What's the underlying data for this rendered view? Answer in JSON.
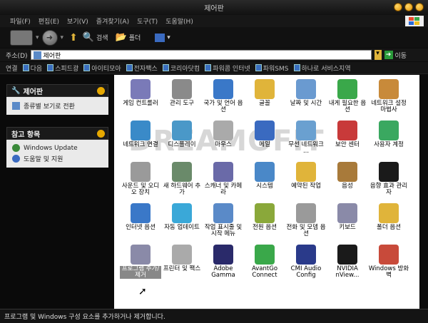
{
  "window": {
    "title": "제어판"
  },
  "menu": [
    "파일(F)",
    "편집(E)",
    "보기(V)",
    "즐겨찾기(A)",
    "도구(T)",
    "도움말(H)"
  ],
  "toolbar": {
    "search": "검색",
    "folders": "폴더"
  },
  "address": {
    "label": "주소(D)",
    "value": "제어판",
    "go": "이동"
  },
  "links": {
    "label": "연결",
    "items": [
      "다음",
      "스피드광",
      "아이티모아",
      "전자팩스",
      "코리아닷컴",
      "파워콤 인터넷",
      "파워SMS",
      "하나로 서비스지역"
    ]
  },
  "sidebar": {
    "control_panel": {
      "title": "제어판",
      "item": "종류별 보기로 전환"
    },
    "see_also": {
      "title": "참고 항목",
      "items": [
        "Windows Update",
        "도움말 및 지원"
      ]
    }
  },
  "watermark": "DREAMOFIT",
  "icons": [
    {
      "label": "게임 컨트롤러",
      "color": "#7a7ab8"
    },
    {
      "label": "관리 도구",
      "color": "#8a8a8a"
    },
    {
      "label": "국가 및 언어 옵션",
      "color": "#3a78c8"
    },
    {
      "label": "글꼴",
      "color": "#e0b43a"
    },
    {
      "label": "날짜 및 시간",
      "color": "#6a9ad0"
    },
    {
      "label": "내게 필요한 옵션",
      "color": "#3aa84a"
    },
    {
      "label": "네트워크 설정 마법사",
      "color": "#c88a3a"
    },
    {
      "label": "네트워크 연결",
      "color": "#3a8ac8"
    },
    {
      "label": "디스플레이",
      "color": "#4a98c8"
    },
    {
      "label": "마우스",
      "color": "#aaaaaa"
    },
    {
      "label": "메일",
      "color": "#3a6ac0"
    },
    {
      "label": "무선 네트워크 ...",
      "color": "#6aa0d0"
    },
    {
      "label": "보안 센터",
      "color": "#c83a3a"
    },
    {
      "label": "사용자 계정",
      "color": "#3aa860"
    },
    {
      "label": "사운드 및 오디오 장치",
      "color": "#9a9a9a"
    },
    {
      "label": "새 하드웨어 추가",
      "color": "#6a8a6a"
    },
    {
      "label": "스캐너 및 카메라",
      "color": "#6a6aa8"
    },
    {
      "label": "시스템",
      "color": "#4a88c8"
    },
    {
      "label": "예약된 작업",
      "color": "#e0b43a"
    },
    {
      "label": "음성",
      "color": "#a87a3a"
    },
    {
      "label": "음향 효과 관리자",
      "color": "#1a1a1a"
    },
    {
      "label": "인터넷 옵션",
      "color": "#3a78c8"
    },
    {
      "label": "자동 업데이트",
      "color": "#3aa8d8"
    },
    {
      "label": "작업 표시줄 및 시작 메뉴",
      "color": "#5a8ac8"
    },
    {
      "label": "전원 옵션",
      "color": "#8aa83a"
    },
    {
      "label": "전화 및 모뎀 옵션",
      "color": "#9a9a9a"
    },
    {
      "label": "키보드",
      "color": "#8a8aa8"
    },
    {
      "label": "폴더 옵션",
      "color": "#e0b43a"
    },
    {
      "label": "프로그램 추가/제거",
      "color": "#8a8aa8"
    },
    {
      "label": "프린터 및 팩스",
      "color": "#aaaaaa"
    },
    {
      "label": "Adobe Gamma",
      "color": "#2a2a6a"
    },
    {
      "label": "AvantGo Connect",
      "color": "#3aa84a"
    },
    {
      "label": "CMI Audio Config",
      "color": "#2a3a8a"
    },
    {
      "label": "NVIDIA nView...",
      "color": "#1a1a1a"
    },
    {
      "label": "Windows 방화벽",
      "color": "#c84a3a"
    }
  ],
  "status": "프로그램 및 Windows 구성 요소를 추가하거나 제거합니다."
}
